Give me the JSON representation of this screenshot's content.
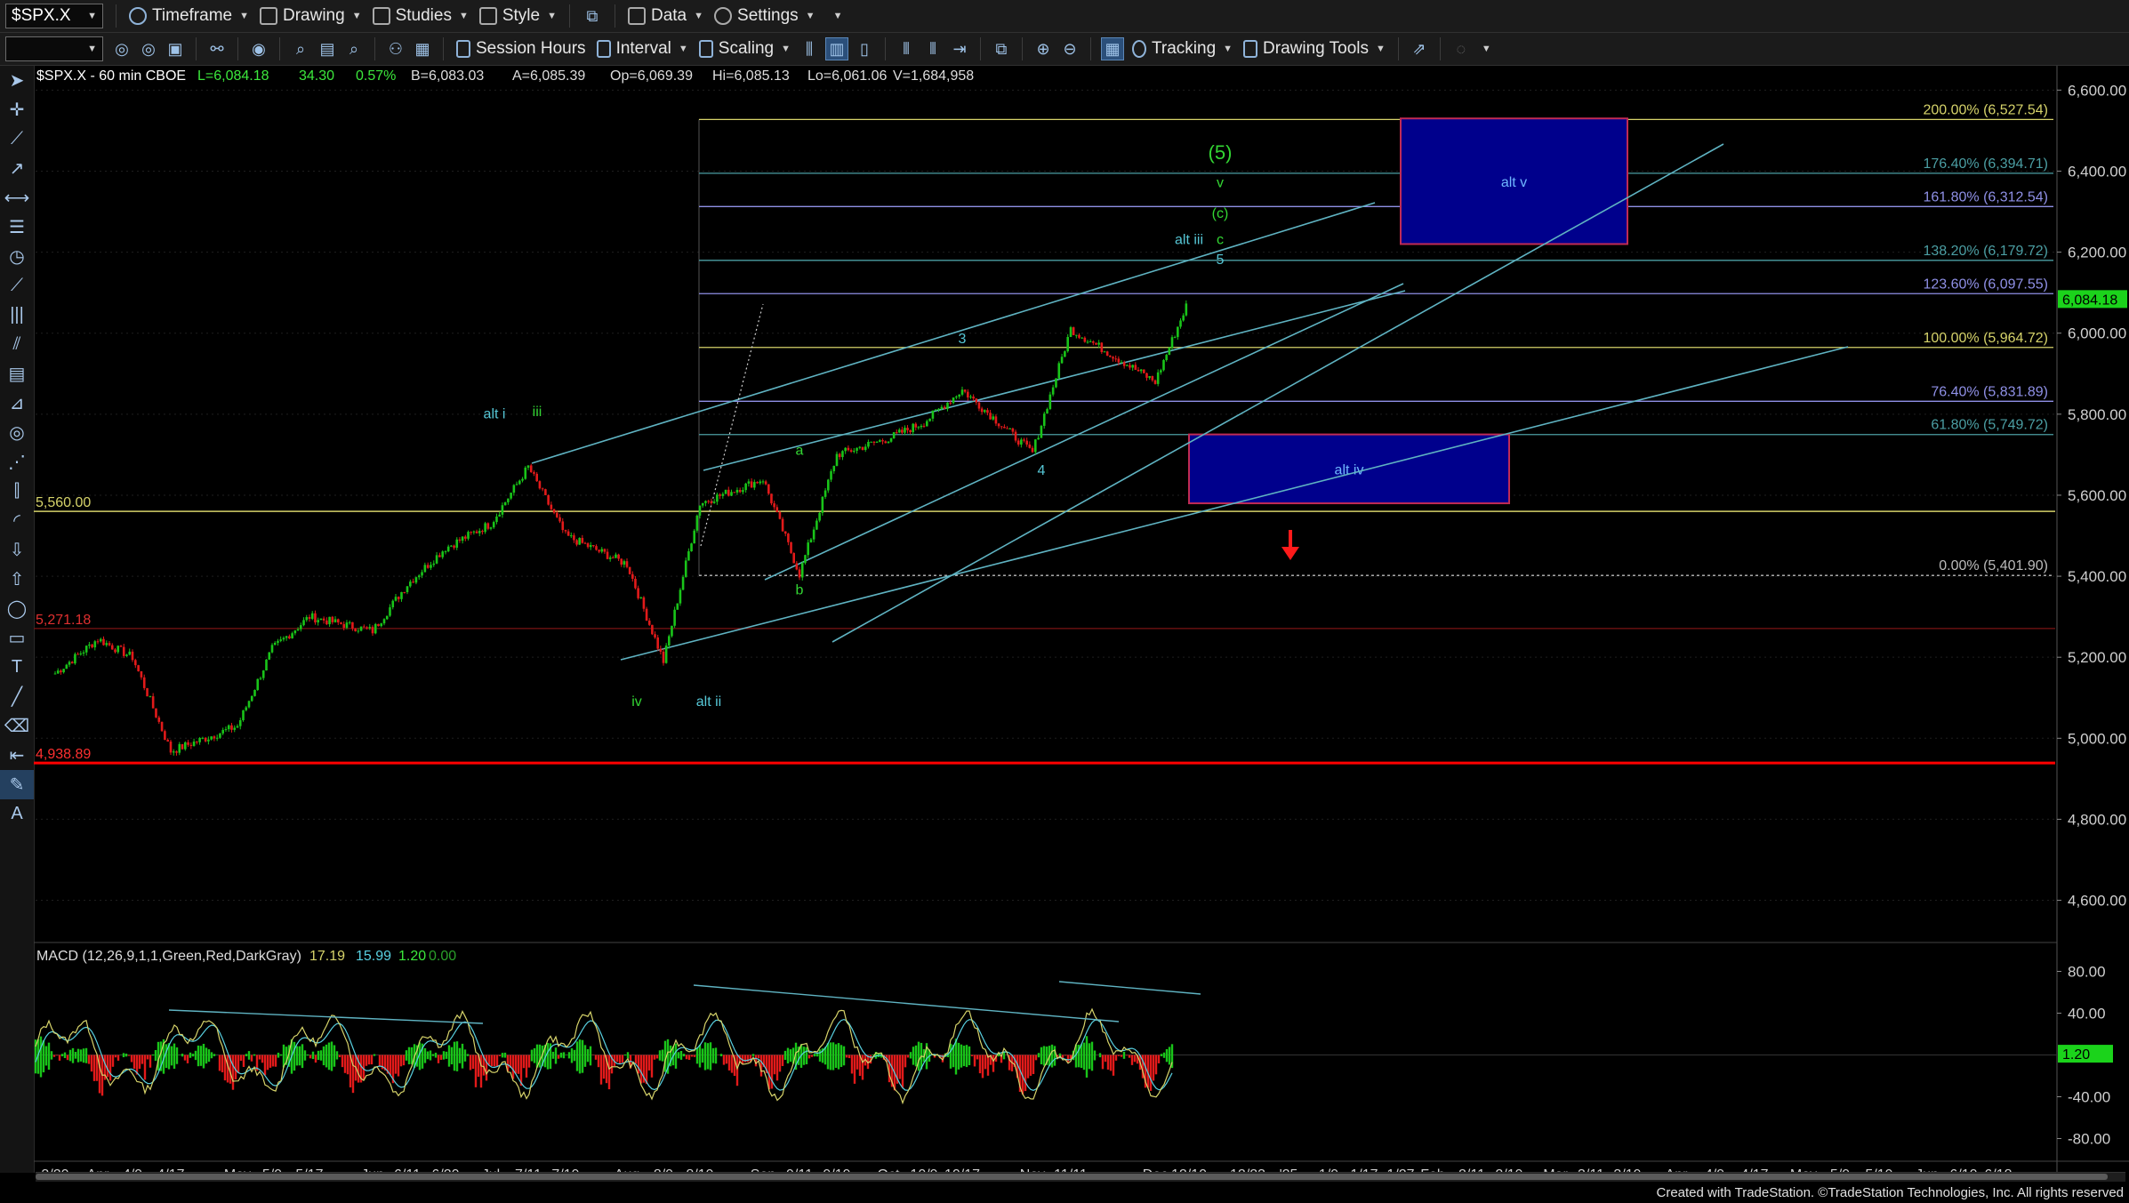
{
  "toolbar": {
    "symbol": "$SPX.X",
    "timeframe": "Timeframe",
    "drawing": "Drawing",
    "studies": "Studies",
    "style": "Style",
    "data": "Data",
    "settings": "Settings",
    "interval_box": "",
    "session_hours": "Session Hours",
    "interval": "Interval",
    "scaling": "Scaling",
    "tracking": "Tracking",
    "drawing_tools": "Drawing Tools"
  },
  "header": {
    "title": "$SPX.X - 60 min  CBOE",
    "last": "L=6,084.18",
    "change": "34.30",
    "pct": "0.57%",
    "bid": "B=6,083.03",
    "ask": "A=6,085.39",
    "open": "Op=6,069.39",
    "high": "Hi=6,085.13",
    "low": "Lo=6,061.06",
    "vol": "V=1,684,958"
  },
  "footer": {
    "credit": "Created with TradeStation. ©TradeStation Technologies, Inc. All rights reserved"
  },
  "colors": {
    "up": "#19c419",
    "down": "#e21a1a",
    "price_axis_label": "#1bd31b",
    "fib_yellow": "#d6d36a",
    "fib_purple": "#8f90e6",
    "fib_teal": "#4b9ea3",
    "trend": "#5fb3c2",
    "box_fill": "#00008c",
    "box_border": "#c02b55",
    "red_line": "#ff0000"
  },
  "chart_data": [
    {
      "type": "candlestick",
      "title": "$SPX.X - 60 min  CBOE",
      "y_ticks": [
        "6,600.00",
        "6,400.00",
        "6,200.00",
        "6,000.00",
        "5,800.00",
        "5,600.00",
        "5,400.00",
        "5,200.00",
        "5,000.00",
        "4,800.00",
        "4,600.00"
      ],
      "ylim": [
        4520,
        6660
      ],
      "x_ticks": [
        "3/20",
        "Apr",
        "4/9",
        "4/17",
        "May",
        "5/9",
        "5/17",
        "Jun",
        "6/11",
        "6/20",
        "Jul",
        "7/11",
        "7/19",
        "Aug",
        "8/9",
        "8/19",
        "Sep",
        "9/11",
        "9/19",
        "Oct",
        "10/9",
        "10/17",
        "Nov",
        "11/11",
        "Dec",
        "12/10",
        "12/23",
        "'25",
        "1/9",
        "1/17",
        "1/27",
        "Feb",
        "2/11",
        "2/19",
        "Mar",
        "3/11",
        "3/19",
        "Apr",
        "4/9",
        "4/17",
        "May",
        "5/9",
        "5/19",
        "Jun",
        "6/10",
        "6/18"
      ],
      "price_path": [
        {
          "x": "3/20",
          "y": 5160
        },
        {
          "x": "Apr",
          "y": 5245
        },
        {
          "x": "4/9",
          "y": 5200
        },
        {
          "x": "4/17",
          "y": 4968
        },
        {
          "x": "May",
          "y": 5030
        },
        {
          "x": "5/9",
          "y": 5220
        },
        {
          "x": "5/17",
          "y": 5300
        },
        {
          "x": "Jun",
          "y": 5265
        },
        {
          "x": "6/11",
          "y": 5380
        },
        {
          "x": "6/20",
          "y": 5470
        },
        {
          "x": "Jul",
          "y": 5530
        },
        {
          "x": "7/11",
          "y": 5670
        },
        {
          "x": "7/19",
          "y": 5500
        },
        {
          "x": "Aug",
          "y": 5430
        },
        {
          "x": "8/9",
          "y": 5190
        },
        {
          "x": "8/19",
          "y": 5580
        },
        {
          "x": "Sep",
          "y": 5640
        },
        {
          "x": "9/11",
          "y": 5405
        },
        {
          "x": "9/19",
          "y": 5700
        },
        {
          "x": "Oct",
          "y": 5740
        },
        {
          "x": "10/9",
          "y": 5780
        },
        {
          "x": "10/17",
          "y": 5860
        },
        {
          "x": "Nov",
          "y": 5705
        },
        {
          "x": "11/11",
          "y": 6010
        },
        {
          "x": "Dec",
          "y": 5880
        },
        {
          "x": "12/10",
          "y": 6084
        }
      ],
      "current_price": "6,084.18",
      "price_levels": [
        {
          "label": "5,560.00",
          "value": 5560
        },
        {
          "label": "5,271.18",
          "value": 5271
        },
        {
          "label": "4,938.89",
          "value": 4939
        }
      ],
      "fib_levels": [
        {
          "label": "200.00% (6,527.54)",
          "value": 6527.54,
          "color": "yellow"
        },
        {
          "label": "176.40% (6,394.71)",
          "value": 6394.71,
          "color": "teal"
        },
        {
          "label": "161.80% (6,312.54)",
          "value": 6312.54,
          "color": "purple"
        },
        {
          "label": "138.20% (6,179.72)",
          "value": 6179.72,
          "color": "teal"
        },
        {
          "label": "123.60% (6,097.55)",
          "value": 6097.55,
          "color": "purple"
        },
        {
          "label": "100.00% (5,964.72)",
          "value": 5964.72,
          "color": "yellow"
        },
        {
          "label": "76.40% (5,831.89)",
          "value": 5831.89,
          "color": "purple"
        },
        {
          "label": "61.80% (5,749.72)",
          "value": 5749.72,
          "color": "teal"
        },
        {
          "label": "0.00% (5,401.90)",
          "value": 5401.9,
          "color": "gray"
        }
      ],
      "zones": [
        {
          "label": "alt v",
          "x_from": "1/27",
          "x_to": "3/19",
          "y_from": 6220,
          "y_to": 6530
        },
        {
          "label": "alt iv",
          "x_from": "12/10",
          "x_to": "2/19",
          "y_from": 5580,
          "y_to": 5750
        }
      ],
      "wave_labels": [
        {
          "text": "alt i",
          "x": "7/11",
          "y": 5790,
          "color": "teal"
        },
        {
          "text": "iii",
          "x": "7/11",
          "y": 5795,
          "color": "green"
        },
        {
          "text": "iv",
          "x": "8/9",
          "y": 5080,
          "color": "green"
        },
        {
          "text": "alt ii",
          "x": "8/19",
          "y": 5080,
          "color": "teal"
        },
        {
          "text": "a",
          "x": "9/11",
          "y": 5700,
          "color": "green"
        },
        {
          "text": "b",
          "x": "9/11",
          "y": 5355,
          "color": "green"
        },
        {
          "text": "3",
          "x": "10/17",
          "y": 5975,
          "color": "teal"
        },
        {
          "text": "4",
          "x": "Nov",
          "y": 5650,
          "color": "teal"
        },
        {
          "text": "5",
          "x": "12/10",
          "y": 6170,
          "color": "teal"
        },
        {
          "text": "c",
          "x": "12/10",
          "y": 6220,
          "color": "green"
        },
        {
          "text": "alt iii",
          "x": "12/10",
          "y": 6220,
          "color": "teal"
        },
        {
          "text": "(c)",
          "x": "12/10",
          "y": 6285,
          "color": "green"
        },
        {
          "text": "v",
          "x": "12/10",
          "y": 6360,
          "color": "green"
        },
        {
          "text": "(5)",
          "x": "12/10",
          "y": 6430,
          "color": "green"
        }
      ]
    },
    {
      "type": "line",
      "title": "MACD (12,26,9,1,1,Green,Red,DarkGray)",
      "values_shown": [
        "17.19",
        "15.99",
        "1.20",
        "0.00"
      ],
      "y_ticks": [
        "80.00",
        "40.00",
        "-40.00",
        "-80.00"
      ],
      "ylim": [
        -100,
        100
      ],
      "current_label": "1.20",
      "histogram_colors": [
        "Green",
        "Red"
      ]
    }
  ]
}
